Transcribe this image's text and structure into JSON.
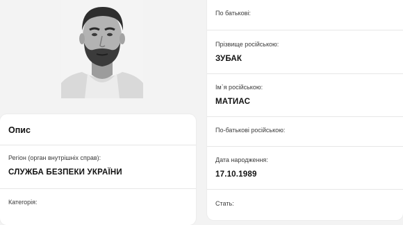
{
  "photo": {
    "alt": "",
    "icon": "portrait-photo"
  },
  "description_card": {
    "title": "Опис",
    "region_label": "Регіон (орган внутрішніх справ):",
    "region_value": "СЛУЖБА БЕЗПЕКИ УКРАЇНИ",
    "category_label": "Категорія:"
  },
  "details_card": {
    "patronymic_label": "По батькові:",
    "surname_ru_label": "Прізвище російською:",
    "surname_ru_value": "ЗУБАК",
    "name_ru_label": "Ім`я російською:",
    "name_ru_value": "МАТИАС",
    "patronymic_ru_label": "По-батькові російською:",
    "birth_date_label": "Дата народження:",
    "birth_date_value": "17.10.1989",
    "sex_label": "Стать:"
  }
}
